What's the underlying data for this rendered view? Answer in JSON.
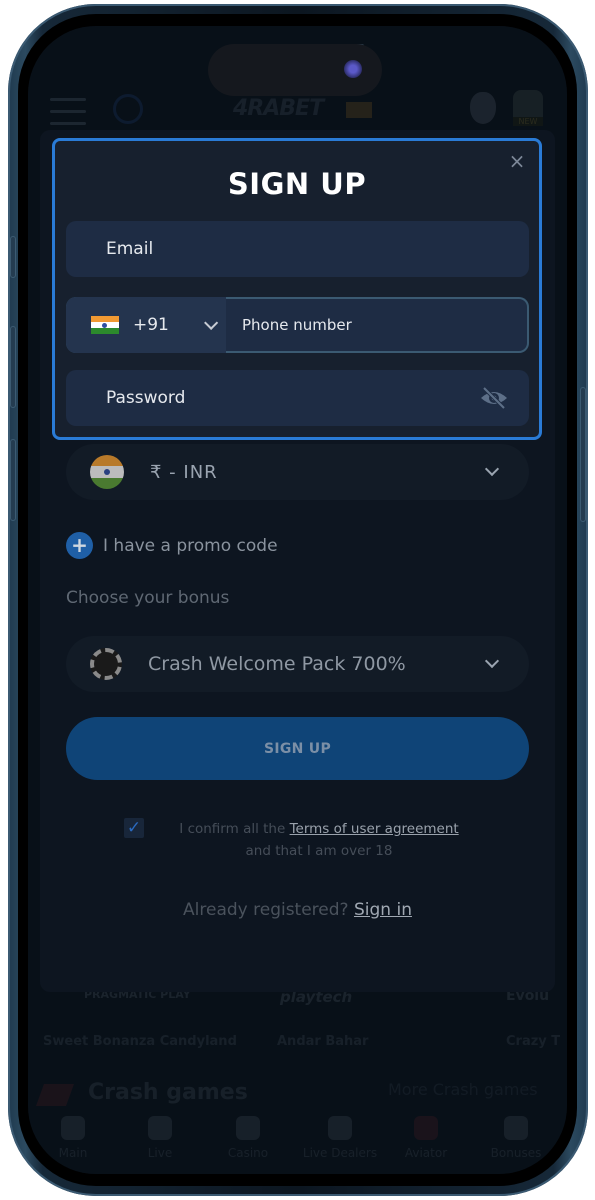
{
  "background_app": {
    "logo": "4RABET",
    "download_badge": "NEW",
    "providers": [
      "PRAGMATIC PLAY",
      "playtech",
      "Evolu"
    ],
    "games": [
      "Sweet Bonanza Candyland",
      "Andar Bahar",
      "Crazy T"
    ],
    "section_title": "Crash games",
    "section_more": "More Crash games",
    "bottom_nav": [
      {
        "label": "Main",
        "icon": "grid-icon"
      },
      {
        "label": "Live",
        "icon": "stadium-icon"
      },
      {
        "label": "Casino",
        "icon": "club-icon"
      },
      {
        "label": "Live Dealers",
        "icon": "dealer-icon"
      },
      {
        "label": "Aviator",
        "icon": "plane-icon"
      },
      {
        "label": "Bonuses",
        "icon": "gift-icon"
      }
    ]
  },
  "modal": {
    "title": "SIGN UP",
    "close_icon": "×",
    "email_placeholder": "Email",
    "country_code": "+91",
    "phone_placeholder": "Phone number",
    "password_placeholder": "Password"
  },
  "form": {
    "currency": "₹ -  INR",
    "promo_label": "I have a promo code",
    "promo_icon": "+",
    "choose_bonus_label": "Choose your bonus",
    "bonus_selected": "Crash Welcome Pack 700%",
    "submit_label": "SIGN UP",
    "agree_prefix": "I confirm all the ",
    "agree_link": "Terms of user agreement",
    "agree_suffix": "and that I am over 18",
    "checkbox_mark": "✓",
    "already_text": "Already registered? ",
    "sign_in_link": "Sign in"
  }
}
